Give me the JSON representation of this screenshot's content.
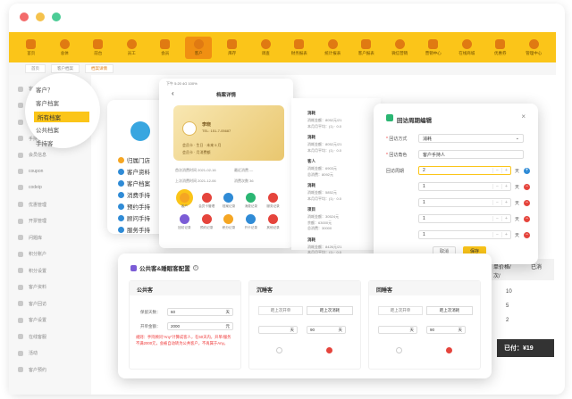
{
  "toolbar": {
    "items": [
      {
        "label": "首页",
        "icon": "home-icon"
      },
      {
        "label": "总体",
        "icon": "overview-icon"
      },
      {
        "label": "前台",
        "icon": "desk-icon"
      },
      {
        "label": "员工",
        "icon": "staff-icon"
      },
      {
        "label": "会员",
        "icon": "member-icon"
      },
      {
        "label": "客户",
        "icon": "customer-icon"
      },
      {
        "label": "库存",
        "icon": "stock-icon"
      },
      {
        "label": "调查",
        "icon": "survey-icon"
      },
      {
        "label": "财务报表",
        "icon": "finance-icon"
      },
      {
        "label": "统计报表",
        "icon": "stats-icon"
      },
      {
        "label": "客户报表",
        "icon": "report-icon"
      },
      {
        "label": "微信营销",
        "icon": "wechat-icon"
      },
      {
        "label": "营销中心",
        "icon": "marketing-icon"
      },
      {
        "label": "在线商城",
        "icon": "mall-icon"
      },
      {
        "label": "优惠券",
        "icon": "coupon-icon"
      },
      {
        "label": "管理中心",
        "icon": "admin-icon"
      }
    ],
    "active_index": 5
  },
  "breadcrumbs": [
    "首页",
    "客户档案",
    "档案详情"
  ],
  "sidebar": {
    "rows": [
      "客户管理",
      "客户档案",
      "公共档案",
      "手持客",
      "会员信息",
      "coupon",
      "codeip",
      "优惠管理",
      "开票管理",
      "问题库",
      "积分账户",
      "积分设置",
      "客户资料",
      "客户回访",
      "客户设置",
      "在线客服",
      "活动",
      "客户预约"
    ]
  },
  "popup_menu": {
    "items": [
      "客户？",
      "客户档案",
      "所有档案",
      "公共档案",
      "手持客"
    ],
    "active_index": 2
  },
  "customer_card": {
    "menu": [
      "归属门店",
      "客户资料",
      "客户档案",
      "消费手持",
      "预约手持",
      "顾问手持",
      "服务手持"
    ]
  },
  "phone": {
    "status": "下午 5:20  4G 100%",
    "title": "档案详情",
    "card": {
      "name": "李晓",
      "phone": "TEL: 151-7-05687",
      "line1": "会员卡  ·  生日 · 未来 5 月",
      "line2": "会员卡  ·  月消费额"
    },
    "lines": [
      "首次消费时间   2021-02-16",
      "最近消费  —",
      "上次消费时间   2021-12-06",
      "消费次数   36"
    ],
    "icons": [
      {
        "label": "客户",
        "color": "#f5a623",
        "icon": "customer-grid-icon",
        "selected": true
      },
      {
        "label": "会员卡管理",
        "color": "#e5443c",
        "icon": "card-grid-icon"
      },
      {
        "label": "档案记录",
        "color": "#2f8bd6",
        "icon": "record-grid-icon"
      },
      {
        "label": "消费记录",
        "color": "#2bb673",
        "icon": "spend-grid-icon"
      },
      {
        "label": "服务记录",
        "color": "#e5443c",
        "icon": "service-grid-icon"
      },
      {
        "label": "回访记录",
        "color": "#7b5cd6",
        "icon": "visit-grid-icon"
      },
      {
        "label": "预约记录",
        "color": "#e5443c",
        "icon": "book-grid-icon"
      },
      {
        "label": "积分记录",
        "color": "#f5a623",
        "icon": "point-grid-icon"
      },
      {
        "label": "开卡记录",
        "color": "#2f8bd6",
        "icon": "open-grid-icon"
      },
      {
        "label": "其他记录",
        "color": "#e5443c",
        "icon": "other-grid-icon"
      }
    ]
  },
  "records": [
    {
      "head": "消耗",
      "lines": [
        "消耗金额：8052元/21",
        "本月月平均：(1) · 0.0"
      ]
    },
    {
      "head": "消耗",
      "lines": [
        "消耗金额：8052元/21",
        "本月月平均：(1) · 0.0"
      ]
    },
    {
      "head": "客人",
      "lines": [
        "消耗金额：6903元",
        "总消费：8092元"
      ]
    },
    {
      "head": "消耗",
      "lines": [
        "消耗金额：5852元",
        "本月月平均：(1) · 0.0"
      ]
    },
    {
      "head": "项目",
      "lines": [
        "消耗金额：30524元",
        "余额：63000元",
        "总消费：30000"
      ]
    },
    {
      "head": "消耗",
      "lines": [
        "消耗金额：8426元/21",
        "本月月平均：(1) · 0.0"
      ]
    }
  ],
  "dialog": {
    "title": "回访周期编辑",
    "method_label": "回访方式",
    "method_value": "消耗",
    "role_label": "回访角色",
    "role_value": "客户手持人",
    "period_label": "回访周期",
    "unit": "天",
    "periods": [
      "2",
      "1",
      "1",
      "1",
      "1"
    ],
    "cancel_label": "取消",
    "save_label": "保存"
  },
  "bg_table": {
    "headers": [
      "单价格/",
      "已消",
      "次/"
    ],
    "cells": [
      "10",
      "5",
      "2"
    ],
    "footer": "已付：¥19"
  },
  "pool_panel": {
    "title": "公共客&睡眠客配置",
    "help": "?",
    "public": {
      "head": "公共客",
      "days_label": "保留天数：",
      "days_value": "60",
      "days_unit": "天",
      "amount_label": "开单金额：",
      "amount_value": "2000",
      "amount_unit": "元",
      "note": "规则：手持顾问“Any”计算成客人，在60天内，开单/服务不满2000元，会被自动转为公共客户，不再属于Any。"
    },
    "sleep": {
      "head": "沉睡客",
      "tab1": "距上次开单",
      "tab2": "距上次消耗",
      "value": "90",
      "unit": "天"
    },
    "return": {
      "head": "回睡客",
      "tab1": "距上次开单",
      "tab2": "距上次消耗",
      "value": "90",
      "unit": "天"
    }
  }
}
